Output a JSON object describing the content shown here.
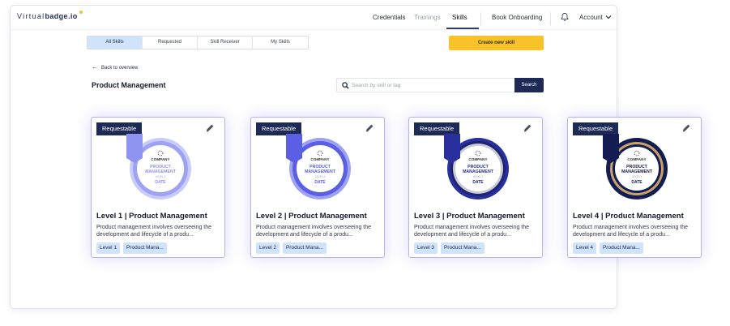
{
  "app": {
    "logo_light": "Virtual",
    "logo_bold": "badge.io"
  },
  "nav": {
    "credentials": "Credentials",
    "trainings": "Trainings",
    "skills": "Skills",
    "book_onboarding": "Book Onboarding",
    "account": "Account"
  },
  "tabs": [
    {
      "label": "All Skills",
      "active": true
    },
    {
      "label": "Requested",
      "active": false
    },
    {
      "label": "Skill Receiver",
      "active": false
    },
    {
      "label": "My Skills",
      "active": false
    }
  ],
  "create_button": "Create new skill",
  "back_link": "Back to overview",
  "page_title": "Product Management",
  "search": {
    "placeholder": "Search by skill or tag",
    "value": "",
    "button": "Search"
  },
  "cards": [
    {
      "status": "Requestable",
      "title": "Level 1 | Product Management",
      "description": "Product management involves overseeing the development and lifecycle of a produ...",
      "tags": [
        "Level 1",
        "Product Mana..."
      ],
      "badge": {
        "company": "COMPANY",
        "line1": "PRODUCT",
        "line2": "MANAGEMENT",
        "level": "LEVEL 1",
        "date": "DATE"
      }
    },
    {
      "status": "Requestable",
      "title": "Level 2 | Product Management",
      "description": "Product management involves overseeing the development and lifecycle of a produ...",
      "tags": [
        "Level 2",
        "Product Mana..."
      ],
      "badge": {
        "company": "COMPANY",
        "line1": "PRODUCT",
        "line2": "MANAGEMENT",
        "level": "LEVEL 2",
        "date": "DATE"
      }
    },
    {
      "status": "Requestable",
      "title": "Level 3 | Product Management",
      "description": "Product management involves overseeing the development and lifecycle of a produ...",
      "tags": [
        "Level 3",
        "Product Mana..."
      ],
      "badge": {
        "company": "COMPANY",
        "line1": "PRODUCT",
        "line2": "MANAGEMENT",
        "level": "LEVEL 3",
        "date": "DATE"
      }
    },
    {
      "status": "Requestable",
      "title": "Level 4 | Product Management",
      "description": "Product management involves overseeing the development and lifecycle of a produ...",
      "tags": [
        "Level 4",
        "Product Mana..."
      ],
      "badge": {
        "company": "COMPANY",
        "line1": "PRODUCT",
        "line2": "MANAGEMENT",
        "level": "LEVEL 4",
        "date": "DATE"
      }
    }
  ],
  "colors": {
    "brand_navy": "#1d2a55",
    "accent_yellow": "#f7c22a",
    "pill_blue": "#cfe3fb",
    "card_glow": "#b7b3f0",
    "badge_level1": "#8f93f2",
    "badge_level2": "#5a5fe4",
    "badge_level3": "#2a2f9e",
    "badge_level4": "#141d52"
  },
  "icons": {
    "bell": "bell-icon",
    "account_chevron": "chevron-down-icon",
    "back": "arrow-left-icon",
    "search": "search-icon",
    "edit": "pencil-icon",
    "badge_spinner": "loader-icon"
  }
}
